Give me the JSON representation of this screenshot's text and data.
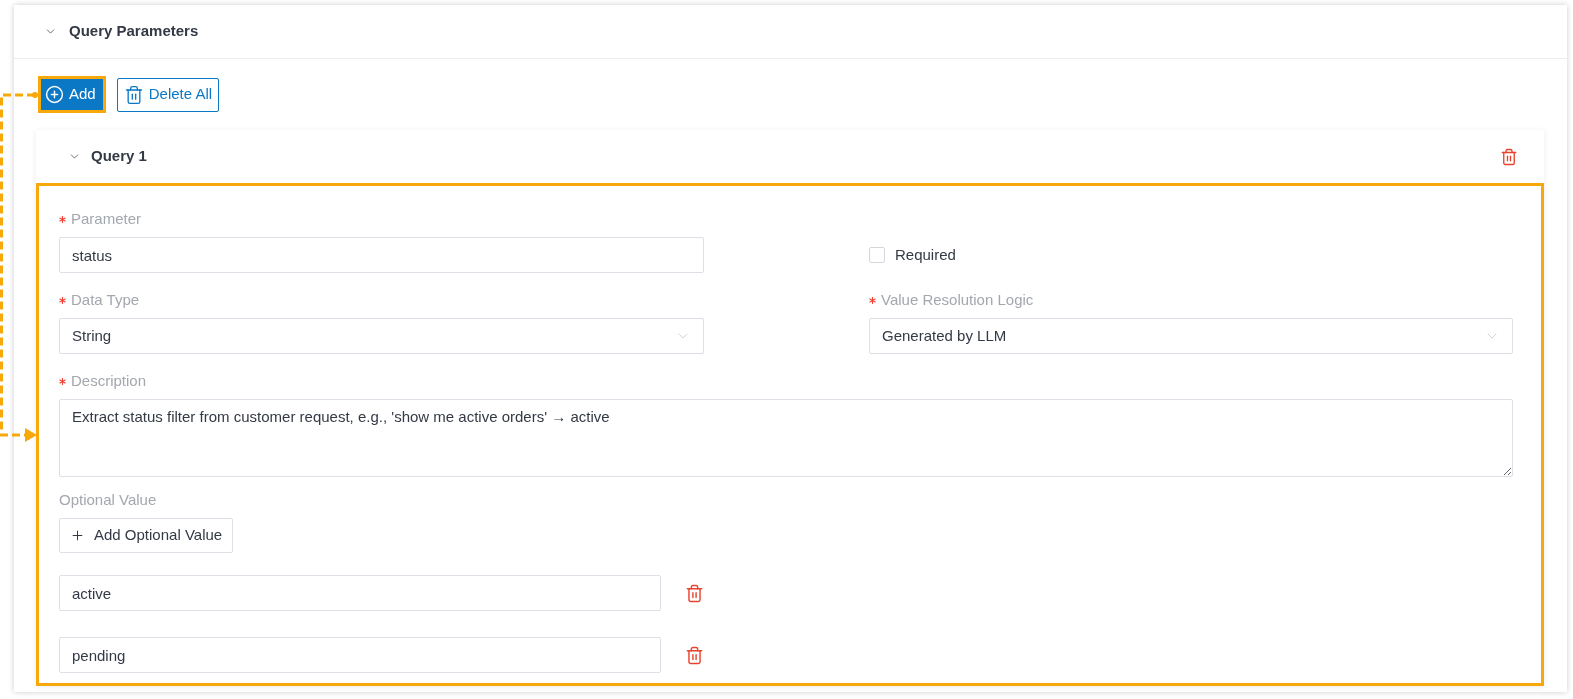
{
  "section": {
    "title": "Query Parameters",
    "expanded": true
  },
  "actions": [
    {
      "kind": "primary",
      "label": "Add",
      "highlighted": true
    },
    {
      "kind": "outline",
      "label": "Delete All",
      "highlighted": false
    }
  ],
  "queries": [
    {
      "title": "Query 1",
      "expanded": true,
      "highlighted": true,
      "parameter": {
        "label": "Parameter",
        "required": true,
        "value": "status"
      },
      "required_option": {
        "label": "Required",
        "checked": false
      },
      "data_type": {
        "label": "Data Type",
        "required": true,
        "value": "String"
      },
      "value_resolution_logic": {
        "label": "Value Resolution Logic",
        "required": true,
        "value": "Generated by LLM"
      },
      "description": {
        "label": "Description",
        "required": true,
        "value": "Extract status filter from customer request, e.g., 'show me active orders' → active"
      },
      "optional_value": {
        "label": "Optional Value",
        "required": false,
        "add_button": "Add Optional Value",
        "values": [
          "active",
          "pending"
        ]
      }
    }
  ]
}
